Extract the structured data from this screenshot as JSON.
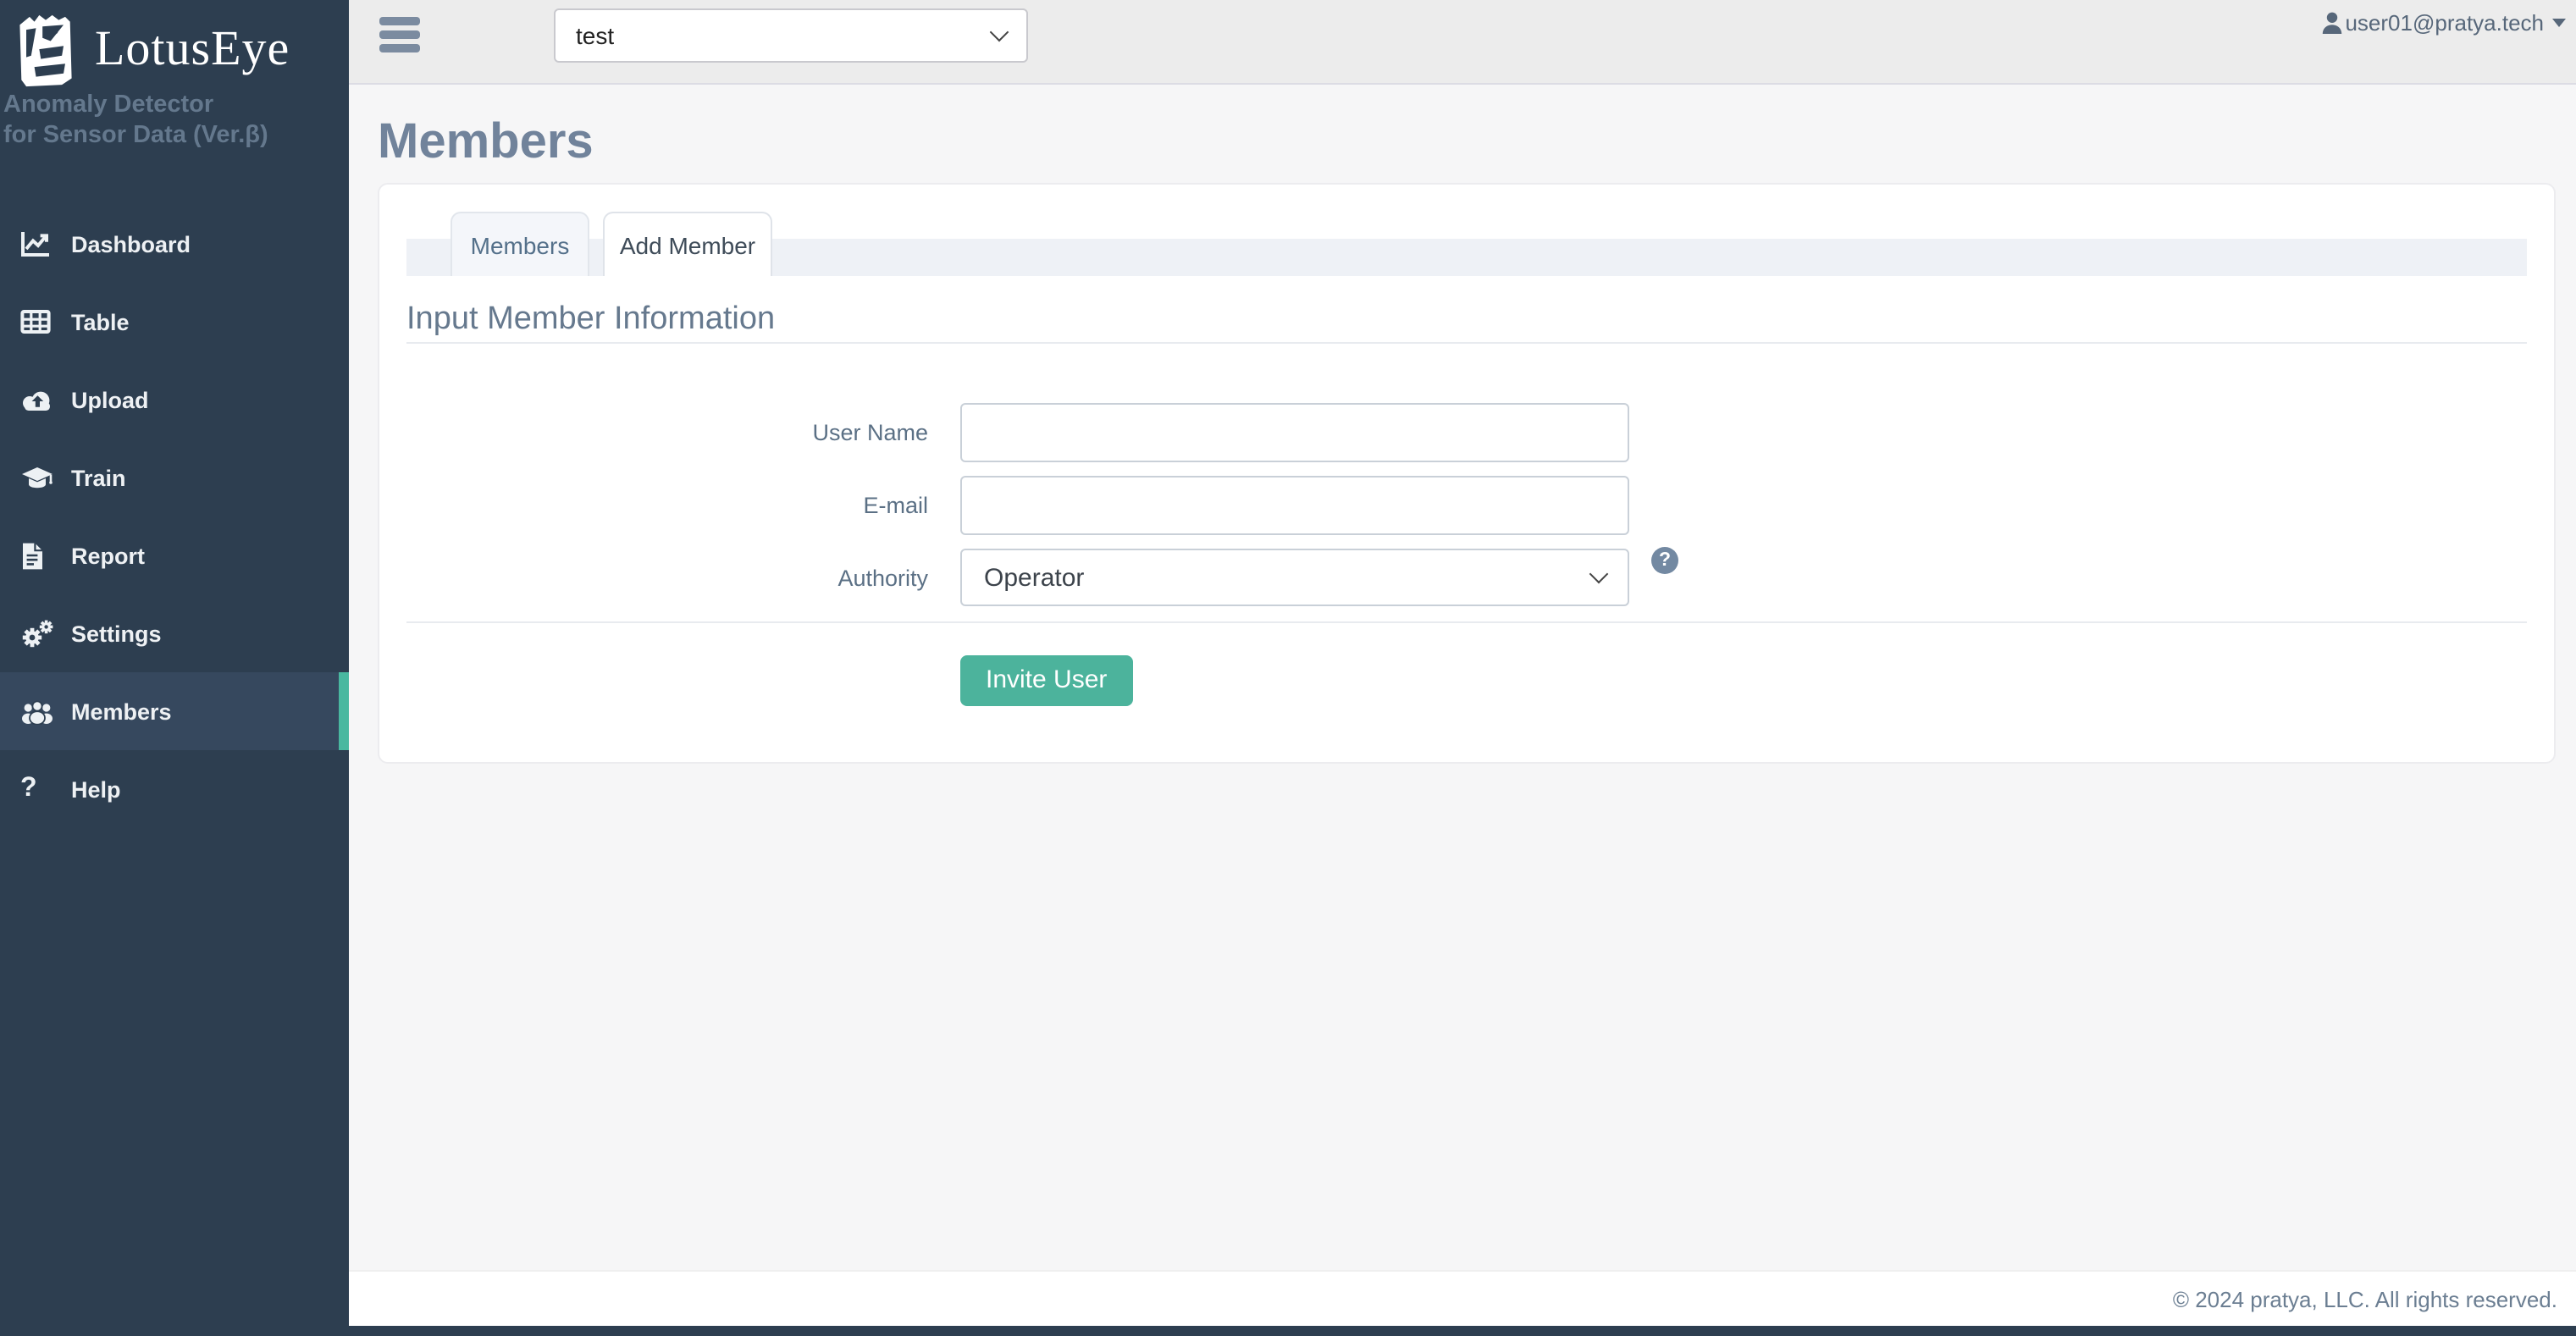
{
  "brand": {
    "logo_text": "LotusEye",
    "subtitle_line1": "Anomaly Detector",
    "subtitle_line2": "for Sensor Data (Ver.β)"
  },
  "sidebar": {
    "items": [
      {
        "icon": "chart-line-icon",
        "label": "Dashboard",
        "active": false
      },
      {
        "icon": "table-icon",
        "label": "Table",
        "active": false
      },
      {
        "icon": "cloud-upload-icon",
        "label": "Upload",
        "active": false
      },
      {
        "icon": "graduation-cap-icon",
        "label": "Train",
        "active": false
      },
      {
        "icon": "file-report-icon",
        "label": "Report",
        "active": false
      },
      {
        "icon": "gears-icon",
        "label": "Settings",
        "active": false
      },
      {
        "icon": "users-icon",
        "label": "Members",
        "active": true
      },
      {
        "icon": "question-icon",
        "label": "Help",
        "active": false
      }
    ]
  },
  "topbar": {
    "project_select_value": "test",
    "user_email": "user01@pratya.tech"
  },
  "page": {
    "title": "Members"
  },
  "tabs": [
    {
      "label": "Members",
      "active": false
    },
    {
      "label": "Add Member",
      "active": true
    }
  ],
  "panel": {
    "section_title": "Input Member Information",
    "fields": [
      {
        "label": "User Name",
        "type": "text",
        "value": "",
        "placeholder": ""
      },
      {
        "label": "E-mail",
        "type": "text",
        "value": "",
        "placeholder": ""
      },
      {
        "label": "Authority",
        "type": "select",
        "value": "Operator",
        "has_help": true
      }
    ],
    "help_glyph": "?",
    "submit_label": "Invite User"
  },
  "footer": {
    "copyright": "© 2024 pratya, LLC. All rights reserved."
  },
  "colors": {
    "sidebar_bg": "#2d3e50",
    "sidebar_active_bg": "#36485e",
    "accent_teal": "#49b8a0",
    "button_green": "#4cb39c",
    "heading_slate": "#71839b",
    "topbar_bg": "#ececec",
    "help_badge": "#7389a2"
  }
}
